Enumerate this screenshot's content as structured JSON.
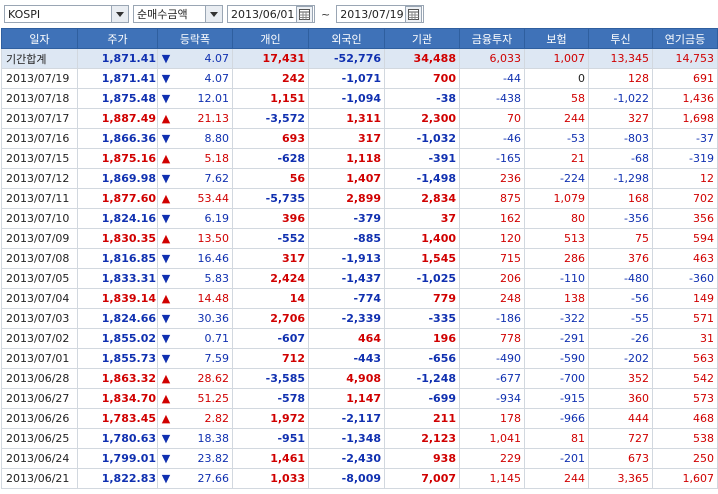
{
  "toolbar": {
    "market": "KOSPI",
    "mode": "순매수금액",
    "date_from": "2013/06/01",
    "date_sep": "~",
    "date_to": "2013/07/19"
  },
  "columns": [
    "일자",
    "주가",
    "등락폭",
    "개인",
    "외국인",
    "기관",
    "금융투자",
    "보험",
    "투신",
    "연기금등"
  ],
  "summary": {
    "label": "기간합계",
    "price": "1,871.41",
    "dir": "down",
    "change": "4.07",
    "individual": "17,431",
    "foreign": "-52,776",
    "institution": "34,488",
    "fin_invest": "6,033",
    "insurance": "1,007",
    "trust": "13,345",
    "pension": "14,753"
  },
  "rows": [
    {
      "date": "2013/07/19",
      "price": "1,871.41",
      "dir": "down",
      "change": "4.07",
      "individual": "242",
      "foreign": "-1,071",
      "institution": "700",
      "fin_invest": "-44",
      "insurance": "0",
      "trust": "128",
      "pension": "691"
    },
    {
      "date": "2013/07/18",
      "price": "1,875.48",
      "dir": "down",
      "change": "12.01",
      "individual": "1,151",
      "foreign": "-1,094",
      "institution": "-38",
      "fin_invest": "-438",
      "insurance": "58",
      "trust": "-1,022",
      "pension": "1,436"
    },
    {
      "date": "2013/07/17",
      "price": "1,887.49",
      "dir": "up",
      "change": "21.13",
      "individual": "-3,572",
      "foreign": "1,311",
      "institution": "2,300",
      "fin_invest": "70",
      "insurance": "244",
      "trust": "327",
      "pension": "1,698"
    },
    {
      "date": "2013/07/16",
      "price": "1,866.36",
      "dir": "down",
      "change": "8.80",
      "individual": "693",
      "foreign": "317",
      "institution": "-1,032",
      "fin_invest": "-46",
      "insurance": "-53",
      "trust": "-803",
      "pension": "-37"
    },
    {
      "date": "2013/07/15",
      "price": "1,875.16",
      "dir": "up",
      "change": "5.18",
      "individual": "-628",
      "foreign": "1,118",
      "institution": "-391",
      "fin_invest": "-165",
      "insurance": "21",
      "trust": "-68",
      "pension": "-319"
    },
    {
      "date": "2013/07/12",
      "price": "1,869.98",
      "dir": "down",
      "change": "7.62",
      "individual": "56",
      "foreign": "1,407",
      "institution": "-1,498",
      "fin_invest": "236",
      "insurance": "-224",
      "trust": "-1,298",
      "pension": "12"
    },
    {
      "date": "2013/07/11",
      "price": "1,877.60",
      "dir": "up",
      "change": "53.44",
      "individual": "-5,735",
      "foreign": "2,899",
      "institution": "2,834",
      "fin_invest": "875",
      "insurance": "1,079",
      "trust": "168",
      "pension": "702"
    },
    {
      "date": "2013/07/10",
      "price": "1,824.16",
      "dir": "down",
      "change": "6.19",
      "individual": "396",
      "foreign": "-379",
      "institution": "37",
      "fin_invest": "162",
      "insurance": "80",
      "trust": "-356",
      "pension": "356"
    },
    {
      "date": "2013/07/09",
      "price": "1,830.35",
      "dir": "up",
      "change": "13.50",
      "individual": "-552",
      "foreign": "-885",
      "institution": "1,400",
      "fin_invest": "120",
      "insurance": "513",
      "trust": "75",
      "pension": "594"
    },
    {
      "date": "2013/07/08",
      "price": "1,816.85",
      "dir": "down",
      "change": "16.46",
      "individual": "317",
      "foreign": "-1,913",
      "institution": "1,545",
      "fin_invest": "715",
      "insurance": "286",
      "trust": "376",
      "pension": "463"
    },
    {
      "date": "2013/07/05",
      "price": "1,833.31",
      "dir": "down",
      "change": "5.83",
      "individual": "2,424",
      "foreign": "-1,437",
      "institution": "-1,025",
      "fin_invest": "206",
      "insurance": "-110",
      "trust": "-480",
      "pension": "-360"
    },
    {
      "date": "2013/07/04",
      "price": "1,839.14",
      "dir": "up",
      "change": "14.48",
      "individual": "14",
      "foreign": "-774",
      "institution": "779",
      "fin_invest": "248",
      "insurance": "138",
      "trust": "-56",
      "pension": "149"
    },
    {
      "date": "2013/07/03",
      "price": "1,824.66",
      "dir": "down",
      "change": "30.36",
      "individual": "2,706",
      "foreign": "-2,339",
      "institution": "-335",
      "fin_invest": "-186",
      "insurance": "-322",
      "trust": "-55",
      "pension": "571"
    },
    {
      "date": "2013/07/02",
      "price": "1,855.02",
      "dir": "down",
      "change": "0.71",
      "individual": "-607",
      "foreign": "464",
      "institution": "196",
      "fin_invest": "778",
      "insurance": "-291",
      "trust": "-26",
      "pension": "31"
    },
    {
      "date": "2013/07/01",
      "price": "1,855.73",
      "dir": "down",
      "change": "7.59",
      "individual": "712",
      "foreign": "-443",
      "institution": "-656",
      "fin_invest": "-490",
      "insurance": "-590",
      "trust": "-202",
      "pension": "563"
    },
    {
      "date": "2013/06/28",
      "price": "1,863.32",
      "dir": "up",
      "change": "28.62",
      "individual": "-3,585",
      "foreign": "4,908",
      "institution": "-1,248",
      "fin_invest": "-677",
      "insurance": "-700",
      "trust": "352",
      "pension": "542"
    },
    {
      "date": "2013/06/27",
      "price": "1,834.70",
      "dir": "up",
      "change": "51.25",
      "individual": "-578",
      "foreign": "1,147",
      "institution": "-699",
      "fin_invest": "-934",
      "insurance": "-915",
      "trust": "360",
      "pension": "573"
    },
    {
      "date": "2013/06/26",
      "price": "1,783.45",
      "dir": "up",
      "change": "2.82",
      "individual": "1,972",
      "foreign": "-2,117",
      "institution": "211",
      "fin_invest": "178",
      "insurance": "-966",
      "trust": "444",
      "pension": "468"
    },
    {
      "date": "2013/06/25",
      "price": "1,780.63",
      "dir": "down",
      "change": "18.38",
      "individual": "-951",
      "foreign": "-1,348",
      "institution": "2,123",
      "fin_invest": "1,041",
      "insurance": "81",
      "trust": "727",
      "pension": "538"
    },
    {
      "date": "2013/06/24",
      "price": "1,799.01",
      "dir": "down",
      "change": "23.82",
      "individual": "1,461",
      "foreign": "-2,430",
      "institution": "938",
      "fin_invest": "229",
      "insurance": "-201",
      "trust": "673",
      "pension": "250"
    },
    {
      "date": "2013/06/21",
      "price": "1,822.83",
      "dir": "down",
      "change": "27.66",
      "individual": "1,033",
      "foreign": "-8,009",
      "institution": "7,007",
      "fin_invest": "1,145",
      "insurance": "244",
      "trust": "3,365",
      "pension": "1,607"
    }
  ],
  "colors": {
    "header_bg": "#3f72b8",
    "up": "#d00000",
    "down": "#1030b0",
    "summary_bg": "#dde7f3"
  }
}
